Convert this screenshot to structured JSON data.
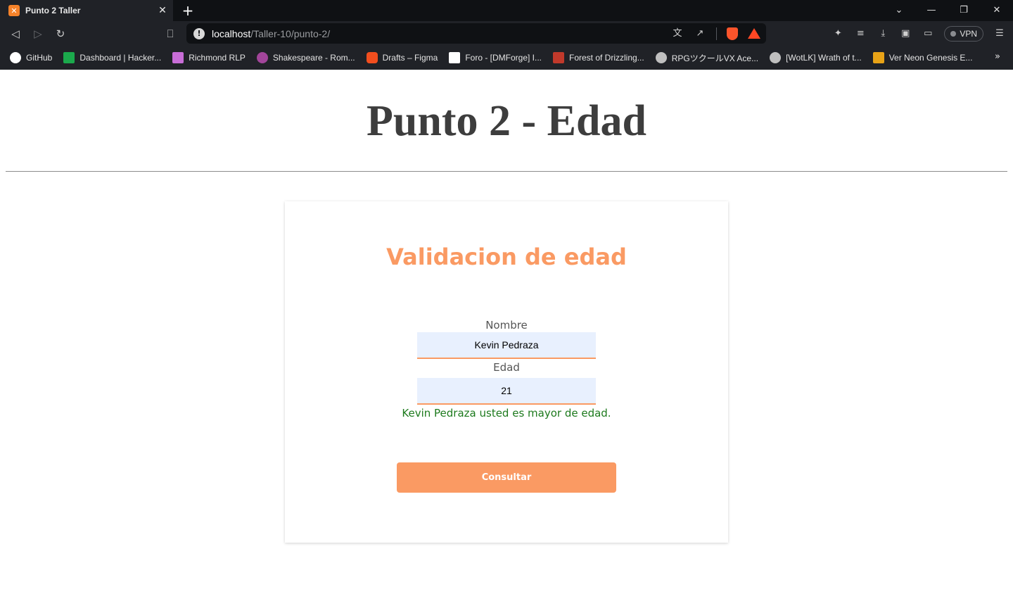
{
  "browser": {
    "tab_title": "Punto 2 Taller",
    "tab_favicon": "XAMPP",
    "url_host": "localhost",
    "url_path": "/Taller-10/punto-2/",
    "vpn_label": "VPN",
    "bookmarks": [
      {
        "label": "GitHub",
        "icon": "github-icon",
        "color": "#ffffff"
      },
      {
        "label": "Dashboard | Hacker...",
        "icon": "hackerrank-icon",
        "color": "#1ba94c"
      },
      {
        "label": "Richmond RLP",
        "icon": "richmond-icon",
        "color": "#c86dd7"
      },
      {
        "label": "Shakespeare - Rom...",
        "icon": "shakespeare-icon",
        "color": "#a2459a"
      },
      {
        "label": "Drafts – Figma",
        "icon": "figma-icon",
        "color": "#f24e1e"
      },
      {
        "label": "Foro - [DMForge] I...",
        "icon": "dmforge-icon",
        "color": "#ffffff"
      },
      {
        "label": "Forest of Drizzling...",
        "icon": "forest-icon",
        "color": "#c0392b"
      },
      {
        "label": "RPGツクールVX Ace...",
        "icon": "globe-icon",
        "color": "#bfbfbf"
      },
      {
        "label": "[WotLK] Wrath of t...",
        "icon": "globe-icon",
        "color": "#bfbfbf"
      },
      {
        "label": "Ver Neon Genesis E...",
        "icon": "animeflv-icon",
        "color": "#e8a317"
      }
    ]
  },
  "page": {
    "title": "Punto 2 - Edad",
    "card_title": "Validacion de edad",
    "name_label": "Nombre",
    "name_value": "Kevin Pedraza",
    "age_label": "Edad",
    "age_value": "21",
    "result_text": "Kevin Pedraza usted es mayor de edad.",
    "submit_label": "Consultar"
  },
  "colors": {
    "accent": "#fa9a63",
    "success": "#1d7a1d",
    "input_bg": "#e8f0fe"
  }
}
